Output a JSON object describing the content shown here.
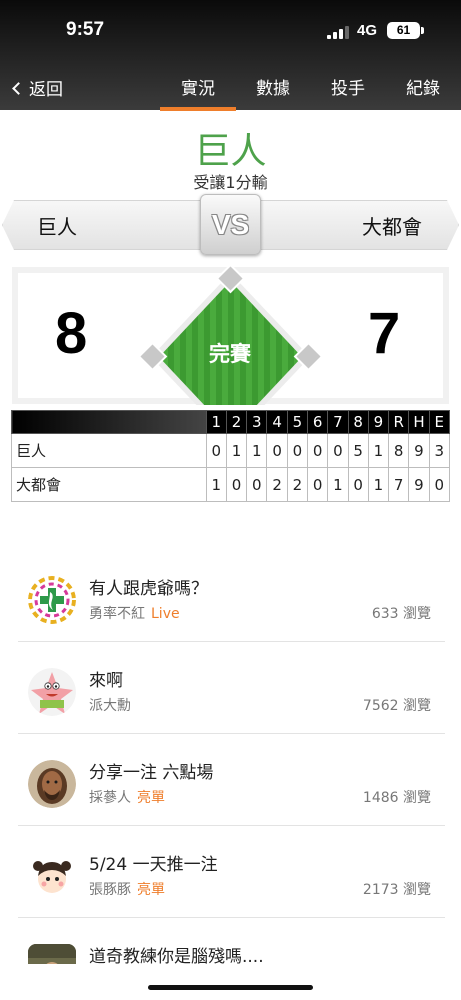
{
  "status_bar": {
    "time": "9:57",
    "network": "4G",
    "battery": "61"
  },
  "nav": {
    "back_label": "返回",
    "tabs": [
      {
        "label": "實況",
        "active": true
      },
      {
        "label": "數據",
        "active": false
      },
      {
        "label": "投手",
        "active": false
      },
      {
        "label": "紀錄",
        "active": false
      }
    ],
    "accent_color": "#ef7e2b"
  },
  "matchup": {
    "winner": "巨人",
    "result": "受讓1分輸",
    "away_team": "巨人",
    "home_team": "大都會",
    "vs_label": "VS",
    "away_score": "8",
    "home_score": "7",
    "game_status": "完賽",
    "winner_color": "#4ea24b"
  },
  "linescore": {
    "headers": [
      "1",
      "2",
      "3",
      "4",
      "5",
      "6",
      "7",
      "8",
      "9",
      "R",
      "H",
      "E"
    ],
    "rows": [
      {
        "team": "巨人",
        "values": [
          "0",
          "1",
          "1",
          "0",
          "0",
          "0",
          "0",
          "5",
          "1",
          "8",
          "9",
          "3"
        ]
      },
      {
        "team": "大都會",
        "values": [
          "1",
          "0",
          "0",
          "2",
          "2",
          "0",
          "1",
          "0",
          "1",
          "7",
          "9",
          "0"
        ]
      }
    ]
  },
  "posts": [
    {
      "title": "有人跟虎爺嗎？",
      "author": "勇率不紅",
      "tag": "Live",
      "views": "633 瀏覽",
      "avatar": "flag-badge-avatar"
    },
    {
      "title": "來啊",
      "author": "派大勳",
      "tag": "",
      "views": "7562 瀏覽",
      "avatar": "starfish-avatar"
    },
    {
      "title": "分享一注 六點場",
      "author": "採蔘人",
      "tag": "亮單",
      "views": "1486 瀏覽",
      "avatar": "portrait-avatar"
    },
    {
      "title": "5/24 一天推一注",
      "author": "張豚豚",
      "tag": "亮單",
      "views": "2173 瀏覽",
      "avatar": "cartoon-girl-avatar"
    },
    {
      "title": "道奇教練你是腦殘嗎....",
      "author": "",
      "tag": "",
      "views": "",
      "avatar": "photo-avatar"
    }
  ]
}
